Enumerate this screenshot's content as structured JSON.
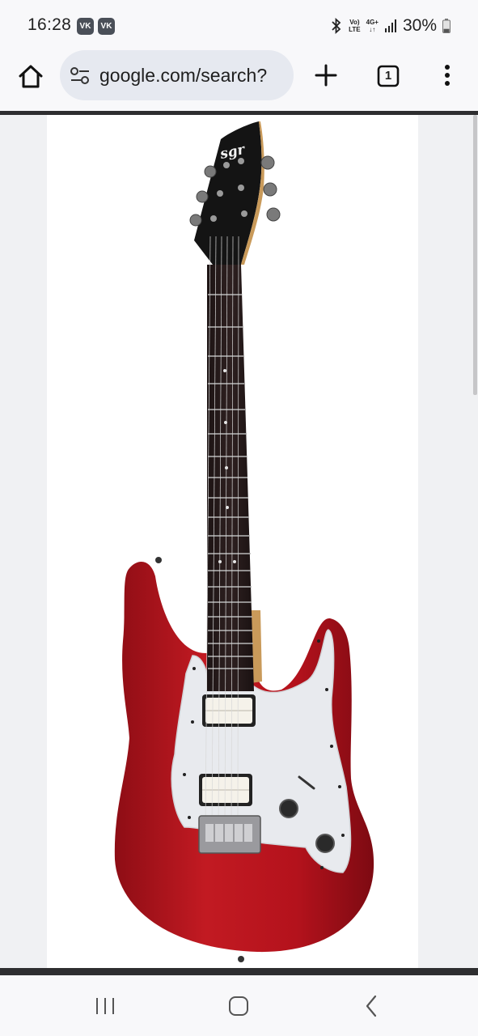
{
  "status_bar": {
    "time": "16:28",
    "notification_icons": [
      "vk-icon",
      "vk-icon"
    ],
    "vk_label": "VK",
    "network_top": "Vo)",
    "network_bottom": "LTE",
    "data_top": "4G+",
    "data_bottom": "↓↑",
    "battery_percent": "30%",
    "battery_level": 0.3,
    "icons": [
      "bluetooth-icon",
      "volte-icon",
      "4g-plus-icon",
      "signal-icon",
      "battery-icon"
    ]
  },
  "browser": {
    "url": "google.com/search?",
    "tab_count": "1",
    "icons": [
      "home-icon",
      "site-settings-icon",
      "new-tab-icon",
      "tab-switcher-icon",
      "overflow-menu-icon"
    ]
  },
  "content": {
    "image_subject": "red-electric-guitar",
    "headstock_logo": "sgr",
    "colors": {
      "body_red": "#b4121c",
      "pickguard": "#e8eaee",
      "fretboard": "#2a1c1c",
      "neck_wood": "#c99a5a",
      "headstock": "#141414"
    }
  },
  "navigation": {
    "buttons": [
      "recent-apps-icon",
      "home-icon",
      "back-icon"
    ]
  },
  "theme": {
    "bar_background": "#f8f8fa",
    "url_pill": "#e6e9f0",
    "divider": "#2e2e30",
    "page_background": "#f0f1f3"
  }
}
